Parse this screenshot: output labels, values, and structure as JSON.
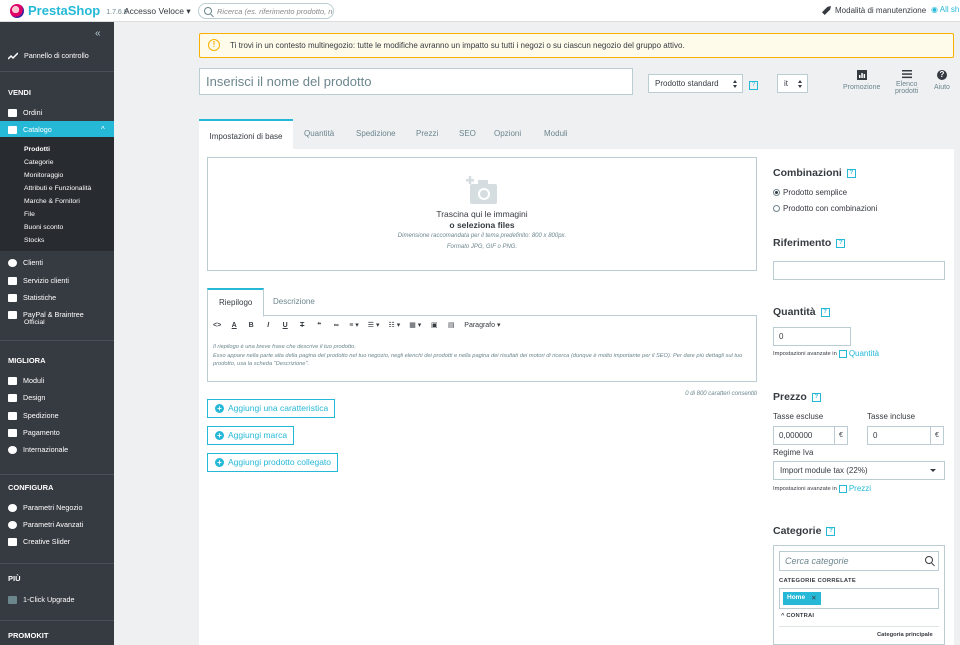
{
  "topbar": {
    "logo": "PrestaShop",
    "version": "1.7.6.0",
    "quick_access": "Accesso Veloce",
    "search_placeholder": "Ricerca (es. riferimento prodotto, nome",
    "maintenance": "Modalità di manutenzione",
    "all_shops": "All sh"
  },
  "sidebar": {
    "dashboard": "Pannello di controllo",
    "sections": {
      "sell": "VENDI",
      "improve": "MIGLIORA",
      "configure": "CONFIGURA",
      "more": "PIÙ",
      "promokit": "PROMOKIT"
    },
    "sell_items": [
      "Ordini",
      "Catalogo"
    ],
    "catalog_sub": [
      "Prodotti",
      "Categorie",
      "Monitoraggio",
      "Attributi e Funzionalità",
      "Marche & Fornitori",
      "File",
      "Buoni sconto",
      "Stocks"
    ],
    "sell_items2": [
      "Clienti",
      "Servizio clienti",
      "Statistiche",
      "PayPal & Braintree",
      "Official"
    ],
    "improve_items": [
      "Moduli",
      "Design",
      "Spedizione",
      "Pagamento",
      "Internazionale"
    ],
    "configure_items": [
      "Parametri Negozio",
      "Parametri Avanzati",
      "Creative Slider"
    ],
    "more_items": [
      "1-Click Upgrade"
    ]
  },
  "alert": {
    "text": "Ti trovi in un contesto multinegozio: tutte le modifiche avranno un impatto su tutti i negozi o su ciascun negozio del gruppo attivo."
  },
  "header": {
    "name_placeholder": "Inserisci il nome del prodotto",
    "product_type": "Prodotto standard",
    "lang": "it",
    "tools": {
      "promo": "Promozione",
      "list1": "Elenco",
      "list2": "prodotti",
      "help": "Aiuto"
    }
  },
  "tabs": [
    "Impostazioni di base",
    "Quantità",
    "Spedizione",
    "Prezzi",
    "SEO",
    "Opzioni",
    "Moduli"
  ],
  "dropzone": {
    "line1": "Trascina qui le immagini",
    "line2": "o seleziona files",
    "line3": "Dimensione raccomandata per il tema predefinito: 800 x 800px.",
    "line4": "Formato JPG, GIF o PNG."
  },
  "description": {
    "tabs": [
      "Riepilogo",
      "Descrizione"
    ],
    "paragraph": "Paragrafo",
    "placeholder1": "Il riepilogo è una breve frase che descrive il tuo prodotto.",
    "placeholder2": "Esso appare nella parte alta della pagina del prodotto nel tuo negozio, negli elenchi dei prodotti e nella pagina dei risultati dei motori di ricerca (dunque è molto importante per il SEO). Per dare più dettagli sul tuo prodotto, usa la scheda \"Descrizione\".",
    "counter": "0 di 800 caratteri consentiti"
  },
  "buttons": {
    "feature": "Aggiungi una caratteristica",
    "brand": "Aggiungi marca",
    "related": "Aggiungi prodotto collegato"
  },
  "right": {
    "combinations": "Combinazioni",
    "simple": "Prodotto semplice",
    "with_comb": "Prodotto con combinazioni",
    "reference": "Riferimento",
    "reference_value": "",
    "quantity": "Quantità",
    "quantity_value": "0",
    "advanced": "Impostazioni avanzate in",
    "quantity_link": "Quantità",
    "price": "Prezzo",
    "tax_excl": "Tasse escluse",
    "tax_incl": "Tasse incluse",
    "price_excl": "0,000000",
    "price_incl": "0",
    "currency": "€",
    "vat_regime": "Regime Iva",
    "vat_value": "Import module tax (22%)",
    "price_link": "Prezzi",
    "categories": "Categorie",
    "cat_search": "Cerca categorie",
    "cat_assoc": "CATEGORIE CORRELATE",
    "tag_home": "Home",
    "tag_x": "✕",
    "contrai": "CONTRAI",
    "cat_main": "Categoria principale"
  },
  "help_mark": "?",
  "icons": {
    "collapse": "«",
    "chevron_up": "^"
  }
}
